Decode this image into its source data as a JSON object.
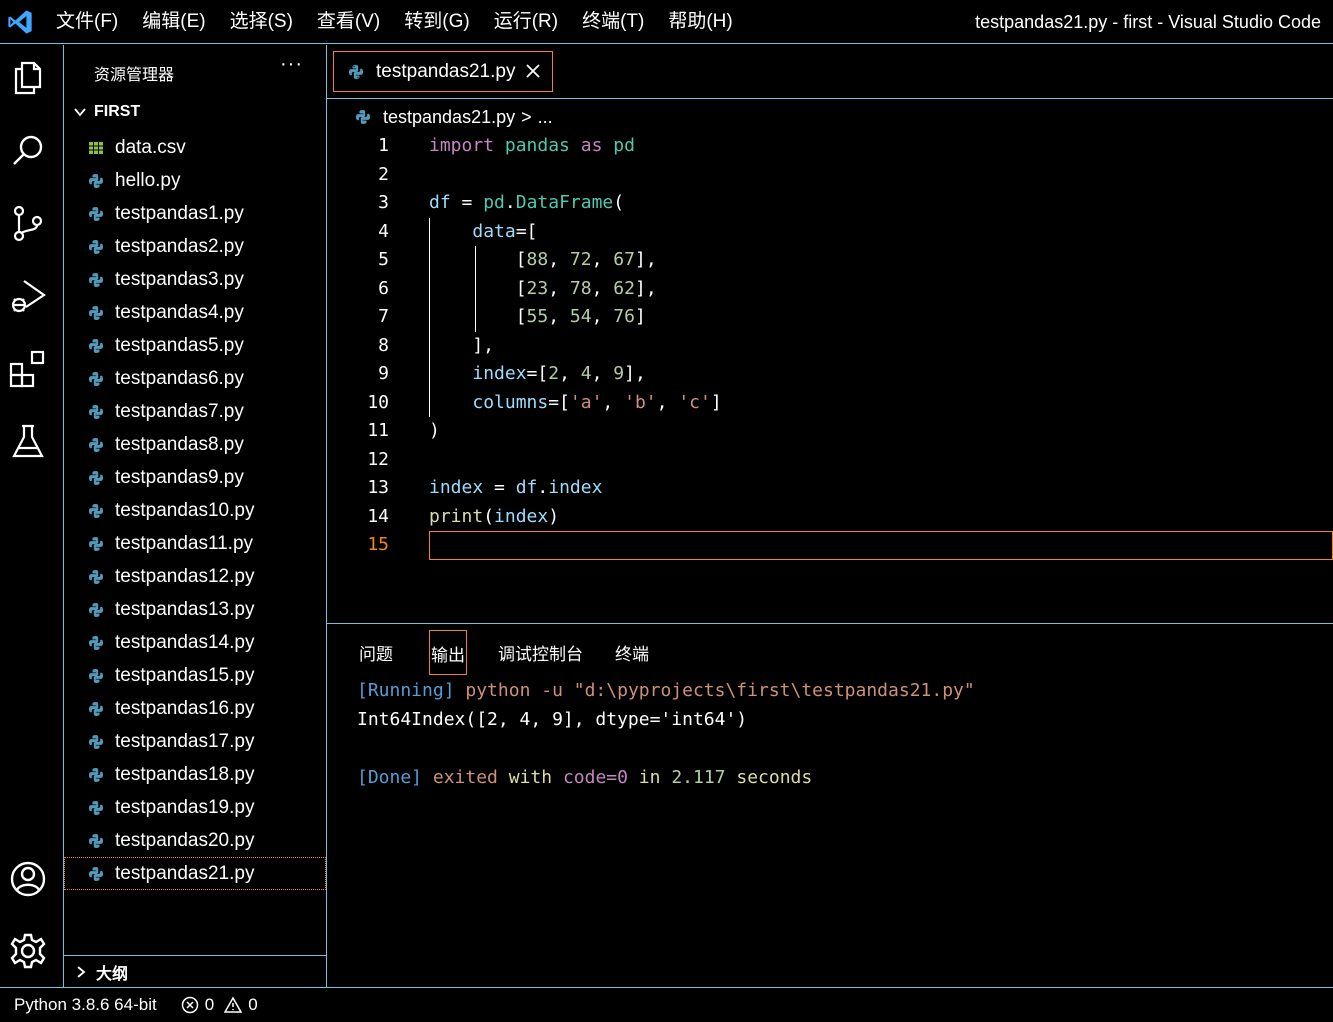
{
  "titlebar": {
    "menu": [
      "文件(F)",
      "编辑(E)",
      "选择(S)",
      "查看(V)",
      "转到(G)",
      "运行(R)",
      "终端(T)",
      "帮助(H)"
    ],
    "window_title": "testpandas21.py - first - Visual Studio Code"
  },
  "activitybar": {
    "icons": [
      "explorer-icon",
      "search-icon",
      "source-control-icon",
      "run-debug-icon",
      "extensions-icon",
      "testing-icon",
      "account-icon",
      "settings-gear-icon"
    ]
  },
  "sidebar": {
    "title": "资源管理器",
    "more": "···",
    "folder": "FIRST",
    "files": [
      {
        "name": "data.csv",
        "type": "csv"
      },
      {
        "name": "hello.py",
        "type": "py"
      },
      {
        "name": "testpandas1.py",
        "type": "py"
      },
      {
        "name": "testpandas2.py",
        "type": "py"
      },
      {
        "name": "testpandas3.py",
        "type": "py"
      },
      {
        "name": "testpandas4.py",
        "type": "py"
      },
      {
        "name": "testpandas5.py",
        "type": "py"
      },
      {
        "name": "testpandas6.py",
        "type": "py"
      },
      {
        "name": "testpandas7.py",
        "type": "py"
      },
      {
        "name": "testpandas8.py",
        "type": "py"
      },
      {
        "name": "testpandas9.py",
        "type": "py"
      },
      {
        "name": "testpandas10.py",
        "type": "py"
      },
      {
        "name": "testpandas11.py",
        "type": "py"
      },
      {
        "name": "testpandas12.py",
        "type": "py"
      },
      {
        "name": "testpandas13.py",
        "type": "py"
      },
      {
        "name": "testpandas14.py",
        "type": "py"
      },
      {
        "name": "testpandas15.py",
        "type": "py"
      },
      {
        "name": "testpandas16.py",
        "type": "py"
      },
      {
        "name": "testpandas17.py",
        "type": "py"
      },
      {
        "name": "testpandas18.py",
        "type": "py"
      },
      {
        "name": "testpandas19.py",
        "type": "py"
      },
      {
        "name": "testpandas20.py",
        "type": "py"
      },
      {
        "name": "testpandas21.py",
        "type": "py",
        "active": true
      }
    ],
    "outline": "大纲"
  },
  "editor": {
    "tab_label": "testpandas21.py",
    "breadcrumb_file": "testpandas21.py",
    "breadcrumb_sep": ">",
    "breadcrumb_more": "...",
    "current_line": 15,
    "lines": [
      [
        {
          "t": "import",
          "c": "kw"
        },
        {
          "t": " "
        },
        {
          "t": "pandas",
          "c": "mod"
        },
        {
          "t": " "
        },
        {
          "t": "as",
          "c": "kw"
        },
        {
          "t": " "
        },
        {
          "t": "pd",
          "c": "mod"
        }
      ],
      [],
      [
        {
          "t": "df",
          "c": "var"
        },
        {
          "t": " = "
        },
        {
          "t": "pd",
          "c": "mod"
        },
        {
          "t": "."
        },
        {
          "t": "DataFrame",
          "c": "mod"
        },
        {
          "t": "("
        }
      ],
      [
        {
          "t": "    "
        },
        {
          "t": "data",
          "c": "var"
        },
        {
          "t": "=["
        }
      ],
      [
        {
          "t": "        ["
        },
        {
          "t": "88",
          "c": "num"
        },
        {
          "t": ", "
        },
        {
          "t": "72",
          "c": "num"
        },
        {
          "t": ", "
        },
        {
          "t": "67",
          "c": "num"
        },
        {
          "t": "],"
        }
      ],
      [
        {
          "t": "        ["
        },
        {
          "t": "23",
          "c": "num"
        },
        {
          "t": ", "
        },
        {
          "t": "78",
          "c": "num"
        },
        {
          "t": ", "
        },
        {
          "t": "62",
          "c": "num"
        },
        {
          "t": "],"
        }
      ],
      [
        {
          "t": "        ["
        },
        {
          "t": "55",
          "c": "num"
        },
        {
          "t": ", "
        },
        {
          "t": "54",
          "c": "num"
        },
        {
          "t": ", "
        },
        {
          "t": "76",
          "c": "num"
        },
        {
          "t": "]"
        }
      ],
      [
        {
          "t": "    ],"
        }
      ],
      [
        {
          "t": "    "
        },
        {
          "t": "index",
          "c": "var"
        },
        {
          "t": "=["
        },
        {
          "t": "2",
          "c": "num"
        },
        {
          "t": ", "
        },
        {
          "t": "4",
          "c": "num"
        },
        {
          "t": ", "
        },
        {
          "t": "9",
          "c": "num"
        },
        {
          "t": "],"
        }
      ],
      [
        {
          "t": "    "
        },
        {
          "t": "columns",
          "c": "var"
        },
        {
          "t": "=["
        },
        {
          "t": "'a'",
          "c": "str"
        },
        {
          "t": ", "
        },
        {
          "t": "'b'",
          "c": "str"
        },
        {
          "t": ", "
        },
        {
          "t": "'c'",
          "c": "str"
        },
        {
          "t": "]"
        }
      ],
      [
        {
          "t": ")"
        }
      ],
      [],
      [
        {
          "t": "index",
          "c": "var"
        },
        {
          "t": " = "
        },
        {
          "t": "df",
          "c": "var"
        },
        {
          "t": "."
        },
        {
          "t": "index",
          "c": "var"
        }
      ],
      [
        {
          "t": "print",
          "c": "fn"
        },
        {
          "t": "("
        },
        {
          "t": "index",
          "c": "var"
        },
        {
          "t": ")"
        }
      ],
      []
    ]
  },
  "panel": {
    "tabs": [
      "问题",
      "输出",
      "调试控制台",
      "终端"
    ],
    "active_tab": "输出",
    "output": [
      [
        {
          "t": "[Running]",
          "c": "o-run"
        },
        {
          "t": " python -u \"d:\\pyprojects\\first\\testpandas21.py\"",
          "c": "o-gray"
        }
      ],
      [
        {
          "t": "Int64Index([2, 4, 9], dtype='int64')"
        }
      ],
      [],
      [
        {
          "t": "[Done]",
          "c": "o-run"
        },
        {
          "t": " exited ",
          "c": "o-gray"
        },
        {
          "t": "with",
          "c": "o-yellow"
        },
        {
          "t": " "
        },
        {
          "t": "code=0",
          "c": "o-code"
        },
        {
          "t": " in ",
          "c": "o-yellow"
        },
        {
          "t": "2.117",
          "c": "o-num"
        },
        {
          "t": " seconds",
          "c": "o-yellow"
        }
      ]
    ]
  },
  "statusbar": {
    "interpreter": "Python 3.8.6 64-bit",
    "errors": "0",
    "warnings": "0"
  },
  "colors": {
    "border": "#6fc3df",
    "focus": "#f38518",
    "python_icon": "#519aba",
    "csv_icon": "#8bc34a"
  }
}
